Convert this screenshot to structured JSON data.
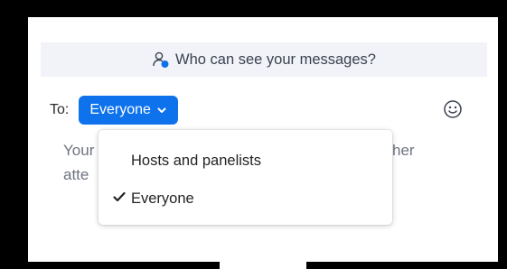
{
  "privacy_bar": {
    "text": "Who can see your messages?",
    "icon": "people-icon"
  },
  "compose": {
    "to_label": "To:",
    "recipient": "Everyone",
    "placeholder_line1": "Your",
    "placeholder_line1_end": "her",
    "placeholder_line2": "atte"
  },
  "emoji": {
    "icon": "smiley-icon"
  },
  "dropdown": {
    "items": [
      {
        "label": "Hosts and panelists",
        "selected": false
      },
      {
        "label": "Everyone",
        "selected": true
      }
    ]
  },
  "colors": {
    "accent": "#0e72ed",
    "bar_bg": "#f1f3f8",
    "placeholder": "#6e7380"
  }
}
